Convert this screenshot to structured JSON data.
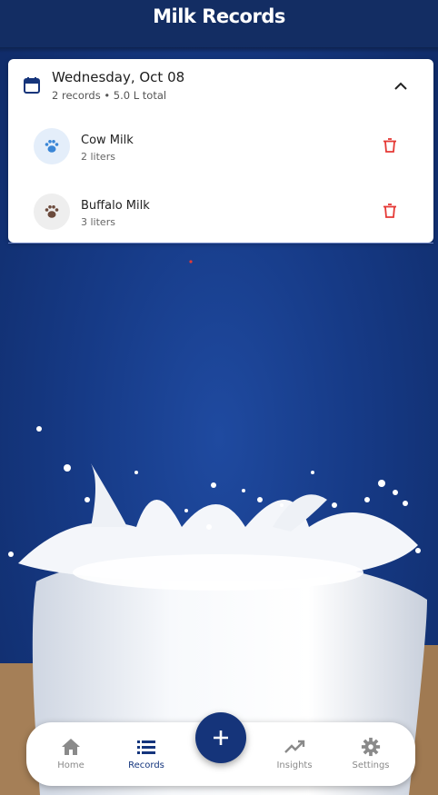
{
  "app": {
    "title": "Milk Records"
  },
  "day": {
    "title": "Wednesday, Oct 08",
    "summary": "2 records • 5.0 L total",
    "records": [
      {
        "name": "Cow Milk",
        "quantity": "2 liters",
        "icon": "paw-icon",
        "icon_color": "#3a86d6",
        "avatar_bg": "#e4eefa"
      },
      {
        "name": "Buffalo Milk",
        "quantity": "3 liters",
        "icon": "paw-icon",
        "icon_color": "#6b4a3c",
        "avatar_bg": "#eeeeee"
      }
    ]
  },
  "nav": {
    "items": [
      {
        "label": "Home",
        "icon": "home-icon",
        "active": false
      },
      {
        "label": "Records",
        "icon": "list-icon",
        "active": true
      },
      {
        "label": "Insights",
        "icon": "trending-up-icon",
        "active": false
      },
      {
        "label": "Settings",
        "icon": "gear-icon",
        "active": false
      }
    ],
    "fab_icon": "plus-icon"
  },
  "colors": {
    "primary": "#15347a",
    "delete": "#e53935",
    "background": "#163a86"
  }
}
